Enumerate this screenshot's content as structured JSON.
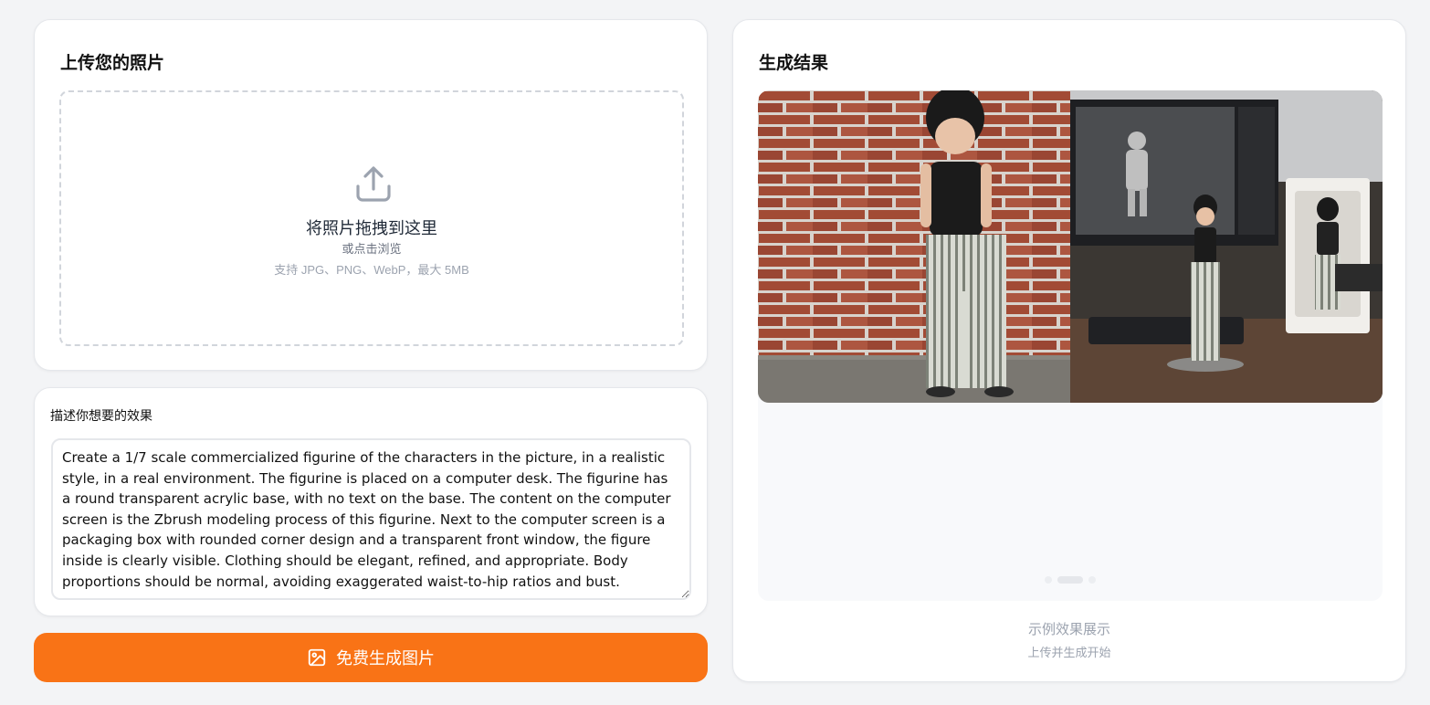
{
  "upload": {
    "title": "上传您的照片",
    "drop_title": "将照片拖拽到这里",
    "browse_text": "或点击浏览",
    "formats_text": "支持 JPG、PNG、WebP，最大 5MB",
    "icon": "upload-icon"
  },
  "prompt": {
    "label": "描述你想要的效果",
    "value": "Create a 1/7 scale commercialized figurine of the characters in the picture, in a realistic style, in a real environment. The figurine is placed on a computer desk. The figurine has a round transparent acrylic base, with no text on the base. The content on the computer screen is the Zbrush modeling process of this figurine. Next to the computer screen is a packaging box with rounded corner design and a transparent front window, the figure inside is clearly visible. Clothing should be elegant, refined, and appropriate. Body proportions should be normal, avoiding exaggerated waist-to-hip ratios and bust."
  },
  "generate": {
    "label": "免费生成图片",
    "icon": "image-icon",
    "color": "#f97316"
  },
  "result": {
    "title": "生成结果",
    "caption": "示例效果展示",
    "subcaption": "上传并生成开始",
    "carousel": {
      "count": 3,
      "active": 1
    }
  }
}
